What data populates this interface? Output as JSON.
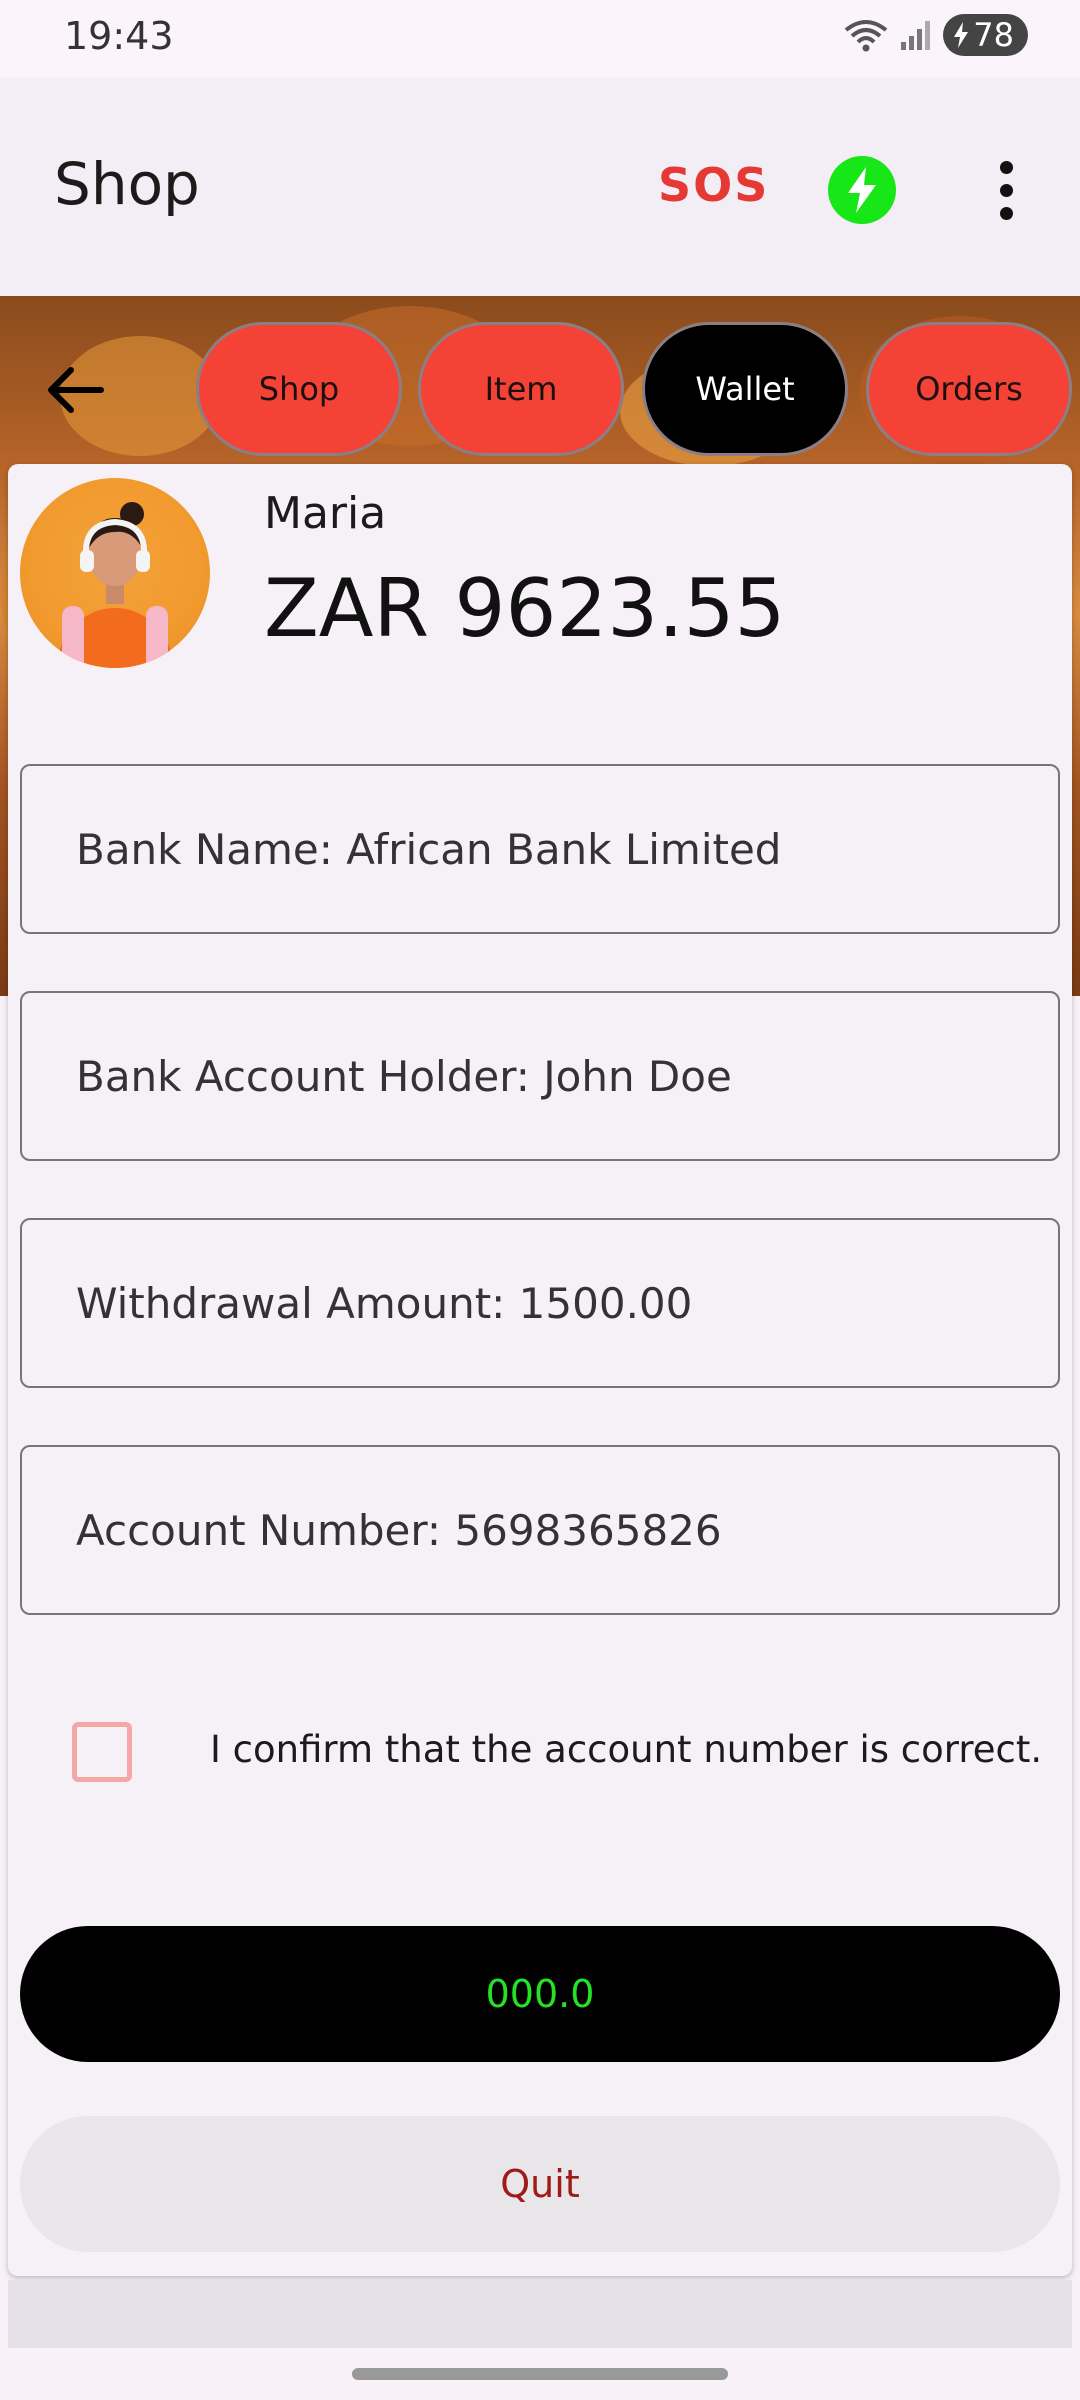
{
  "status_bar": {
    "time": "19:43",
    "battery": "78",
    "icons": [
      "wifi-icon",
      "signal-icon",
      "battery-charging-icon"
    ]
  },
  "app_bar": {
    "title": "Shop",
    "sos_label": "SOS",
    "icons": [
      "bolt-icon",
      "more-vert-icon"
    ]
  },
  "nav": {
    "back_icon": "arrow-back-icon",
    "tabs": [
      {
        "label": "Shop",
        "active": false
      },
      {
        "label": "Item",
        "active": false
      },
      {
        "label": "Wallet",
        "active": true
      },
      {
        "label": "Orders",
        "active": false
      }
    ]
  },
  "profile": {
    "name": "Maria",
    "balance": "ZAR 9623.55"
  },
  "fields": {
    "bank_name": "Bank Name: African Bank Limited",
    "account_holder": "Bank Account Holder: John Doe",
    "withdrawal_amount": "Withdrawal Amount: 1500.00",
    "account_number": "Account Number: 5698365826"
  },
  "confirm": {
    "label": "I confirm that the account number is correct.",
    "checked": false
  },
  "actions": {
    "amount_button": "000.0",
    "quit_button": "Quit"
  },
  "colors": {
    "tab_active": "#000000",
    "tab_inactive": "#f44336",
    "sos": "#e53935",
    "bolt_bg": "#17e617",
    "amount_text": "#25e225",
    "quit_text": "#a11a1a"
  }
}
